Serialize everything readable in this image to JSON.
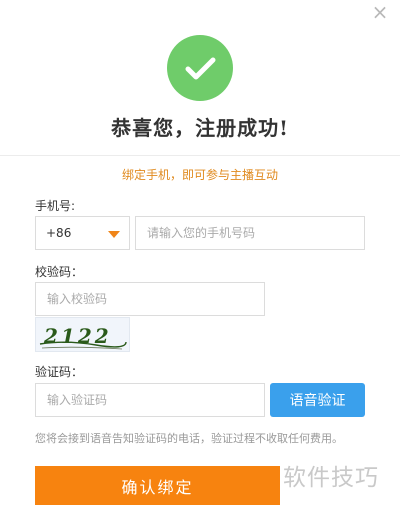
{
  "dialog": {
    "close_glyph": "×",
    "success_title": "恭喜您，注册成功!",
    "bind_tip": "绑定手机，即可参与主播互动"
  },
  "phone": {
    "label": "手机号:",
    "country_code": "+86",
    "placeholder": "请输入您的手机号码"
  },
  "captcha": {
    "label": "校验码：",
    "placeholder": "输入校验码",
    "image_text": "2122"
  },
  "verify": {
    "label": "验证码：",
    "placeholder": "输入验证码",
    "voice_button": "语音验证",
    "voice_hint": "您将会接到语音告知验证码的电话，验证过程不收取任何费用。"
  },
  "actions": {
    "confirm_button": "确认绑定"
  },
  "watermark": "软件技巧",
  "colors": {
    "success_green": "#6fcc6a",
    "tip_orange": "#e08a1e",
    "accent_orange": "#f7830f",
    "voice_blue": "#3aa0ec",
    "captcha_ink": "#2a5a1a"
  },
  "icons": {
    "close": "close-icon",
    "success": "checkmark-icon",
    "dropdown": "chevron-down-icon"
  }
}
